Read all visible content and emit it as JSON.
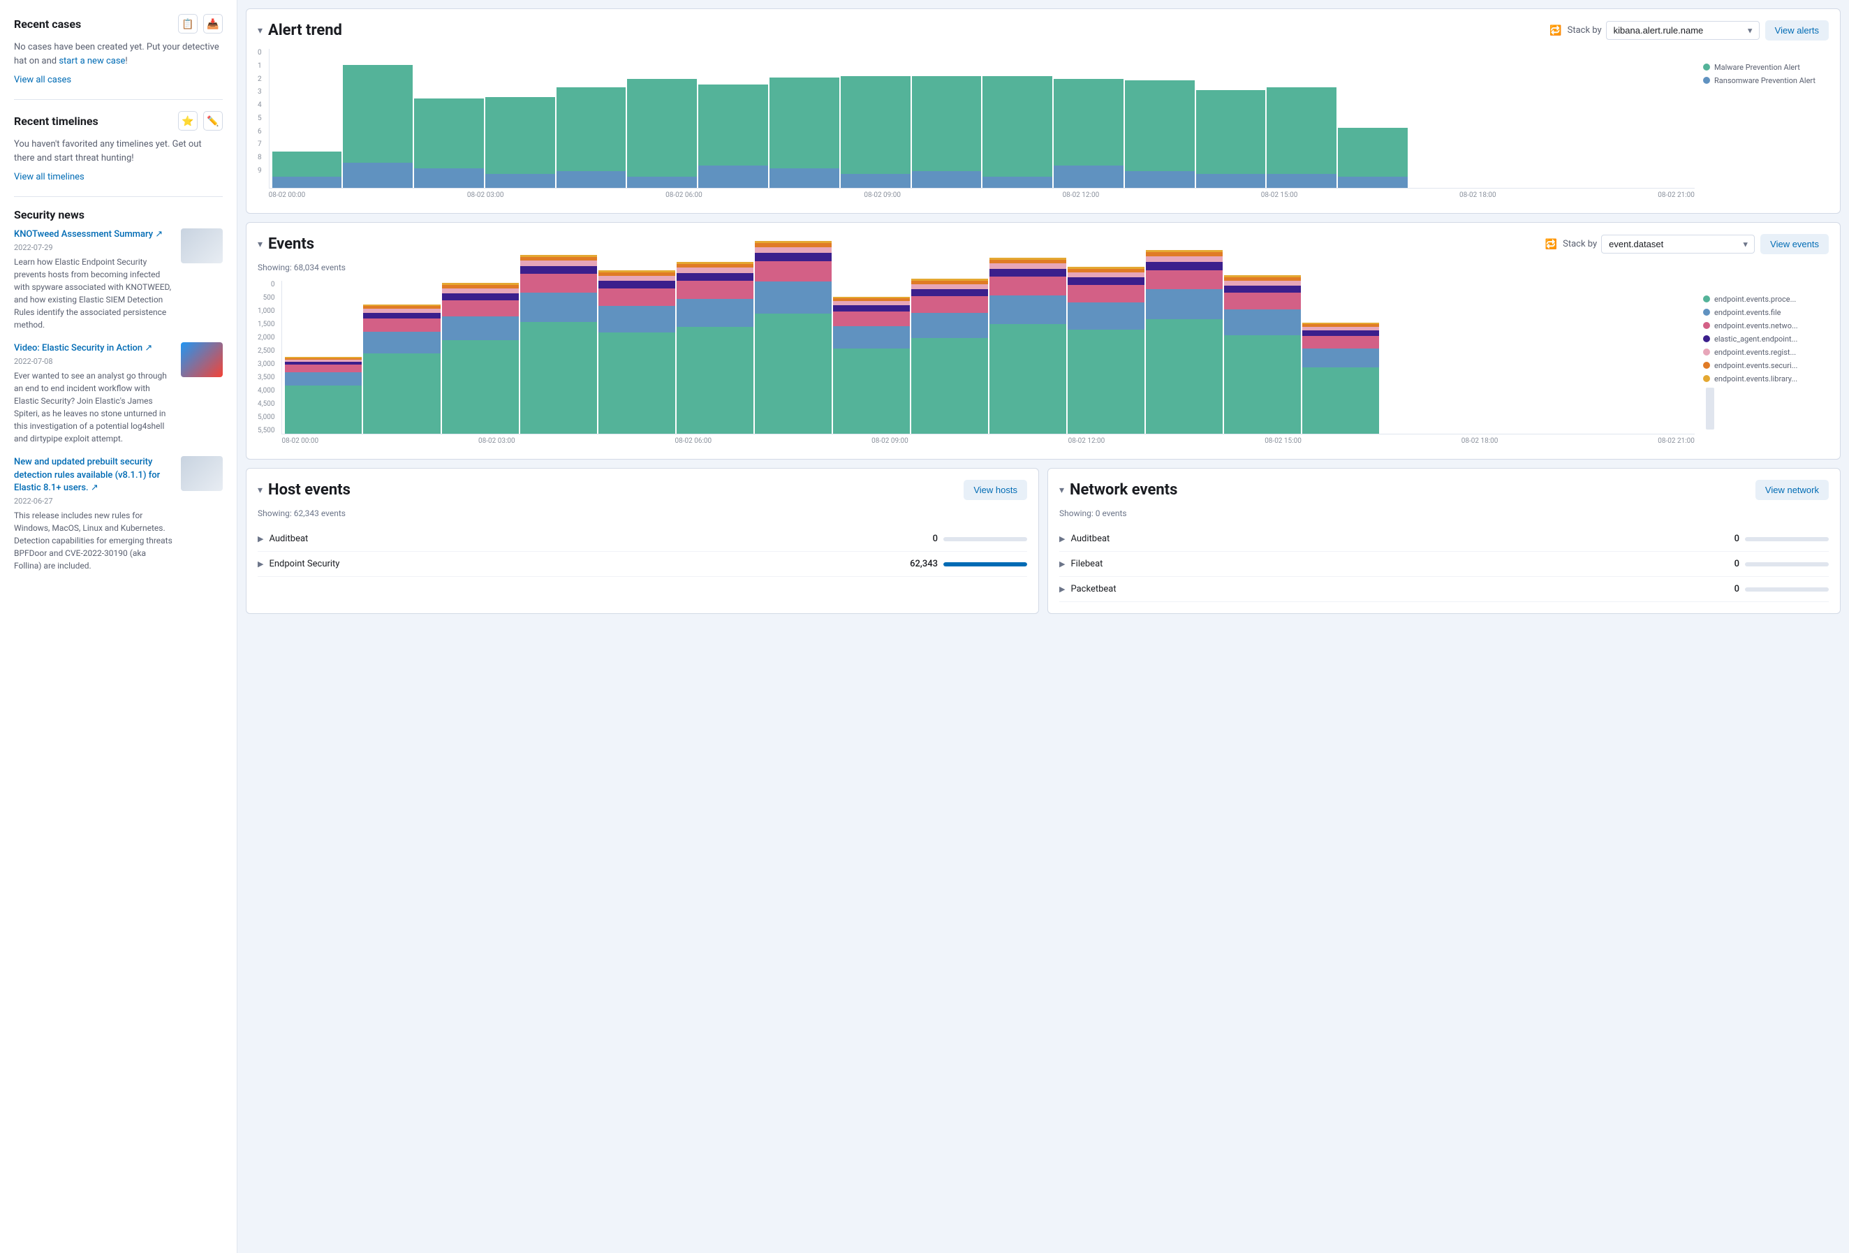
{
  "sidebar": {
    "cases": {
      "title": "Recent cases",
      "empty_text": "No cases have been created yet. Put your detective hat on and ",
      "link_text": "start a new case",
      "link_suffix": "!",
      "view_all": "View all cases",
      "icon1": "📋",
      "icon2": "📥"
    },
    "timelines": {
      "title": "Recent timelines",
      "empty_text": "You haven't favorited any timelines yet. Get out there and start threat hunting!",
      "view_all": "View all timelines",
      "icon1": "⭐",
      "icon2": "✏️"
    },
    "news": {
      "title": "Security news",
      "items": [
        {
          "title": "KNOTweed Assessment Summary ↗",
          "date": "2022-07-29",
          "desc": "Learn how Elastic Endpoint Security prevents hosts from becoming infected with spyware associated with KNOTWEED, and how existing Elastic SIEM Detection Rules identify the associated persistence method.",
          "thumb_type": "plain"
        },
        {
          "title": "Video: Elastic Security in Action ↗",
          "date": "2022-07-08",
          "desc": "Ever wanted to see an analyst go through an end to end incident workflow with Elastic Security? Join Elastic's James Spiteri, as he leaves no stone unturned in this investigation of a potential log4shell and dirtypipe exploit attempt.",
          "thumb_type": "colored"
        },
        {
          "title": "New and updated prebuilt security detection rules available (v8.1.1) for Elastic 8.1+ users. ↗",
          "date": "2022-06-27",
          "desc": "This release includes new rules for Windows, MacOS, Linux and Kubernetes. Detection capabilities for emerging threats BPFDoor and CVE-2022-30190 (aka Follina) are included.",
          "thumb_type": "plain"
        }
      ]
    }
  },
  "alert_trend": {
    "title": "Alert trend",
    "stack_by_label": "Stack by",
    "stack_by_value": "kibana.alert.rule.name",
    "view_btn": "View alerts",
    "legend": [
      {
        "label": "Malware Prevention Alert",
        "color": "#54b399"
      },
      {
        "label": "Ransomware Prevention Alert",
        "color": "#6092c0"
      }
    ],
    "x_labels": [
      "08-02 00:00",
      "08-02 03:00",
      "08-02 06:00",
      "08-02 09:00",
      "08-02 12:00",
      "08-02 15:00",
      "08-02 18:00",
      "08-02 21:00"
    ],
    "y_labels": [
      "0",
      "1",
      "2",
      "3",
      "4",
      "5",
      "6",
      "7",
      "8",
      "9"
    ],
    "bars": [
      {
        "green": 20,
        "blue": 10
      },
      {
        "green": 70,
        "blue": 20
      },
      {
        "green": 50,
        "blue": 15
      },
      {
        "green": 55,
        "blue": 10
      },
      {
        "green": 60,
        "blue": 12
      },
      {
        "green": 72,
        "blue": 8
      },
      {
        "green": 58,
        "blue": 18
      },
      {
        "green": 65,
        "blue": 15
      },
      {
        "green": 70,
        "blue": 10
      },
      {
        "green": 68,
        "blue": 12
      },
      {
        "green": 72,
        "blue": 8
      },
      {
        "green": 62,
        "blue": 18
      },
      {
        "green": 65,
        "blue": 14
      },
      {
        "green": 60,
        "blue": 10
      },
      {
        "green": 68,
        "blue": 12
      },
      {
        "green": 35,
        "blue": 8
      },
      {
        "green": 0,
        "blue": 0
      },
      {
        "green": 0,
        "blue": 0
      },
      {
        "green": 0,
        "blue": 0
      },
      {
        "green": 0,
        "blue": 0
      }
    ]
  },
  "events": {
    "title": "Events",
    "stack_by_label": "Stack by",
    "stack_by_value": "event.dataset",
    "view_btn": "View events",
    "showing": "Showing: 68,034 events",
    "legend": [
      {
        "label": "endpoint.events.proce...",
        "color": "#54b399"
      },
      {
        "label": "endpoint.events.file",
        "color": "#6092c0"
      },
      {
        "label": "endpoint.events.netwo...",
        "color": "#d36086"
      },
      {
        "label": "elastic_agent.endpoint...",
        "color": "#3b1f8c"
      },
      {
        "label": "endpoint.events.regist...",
        "color": "#e7a6b9"
      },
      {
        "label": "endpoint.events.securi...",
        "color": "#e07b26"
      },
      {
        "label": "endpoint.events.library...",
        "color": "#e4a832"
      }
    ],
    "x_labels": [
      "08-02 00:00",
      "08-02 03:00",
      "08-02 06:00",
      "08-02 09:00",
      "08-02 12:00",
      "08-02 15:00",
      "08-02 18:00",
      "08-02 21:00"
    ],
    "y_labels": [
      "0",
      "500",
      "1,000",
      "1,500",
      "2,000",
      "2,500",
      "3,000",
      "3,500",
      "4,000",
      "4,500",
      "5,000",
      "5,500"
    ]
  },
  "host_events": {
    "title": "Host events",
    "view_btn": "View hosts",
    "showing": "Showing: 62,343 events",
    "items": [
      {
        "name": "Auditbeat",
        "count": "0",
        "fill": 0,
        "color": "#d3dae6"
      },
      {
        "name": "Endpoint Security",
        "count": "62,343",
        "fill": 100,
        "color": "#006bb4"
      }
    ]
  },
  "network_events": {
    "title": "Network events",
    "view_btn": "View network",
    "showing": "Showing: 0 events",
    "items": [
      {
        "name": "Auditbeat",
        "count": "0",
        "fill": 0,
        "color": "#d3dae6"
      },
      {
        "name": "Filebeat",
        "count": "0",
        "fill": 0,
        "color": "#d3dae6"
      },
      {
        "name": "Packetbeat",
        "count": "0",
        "fill": 0,
        "color": "#d3dae6"
      }
    ]
  }
}
